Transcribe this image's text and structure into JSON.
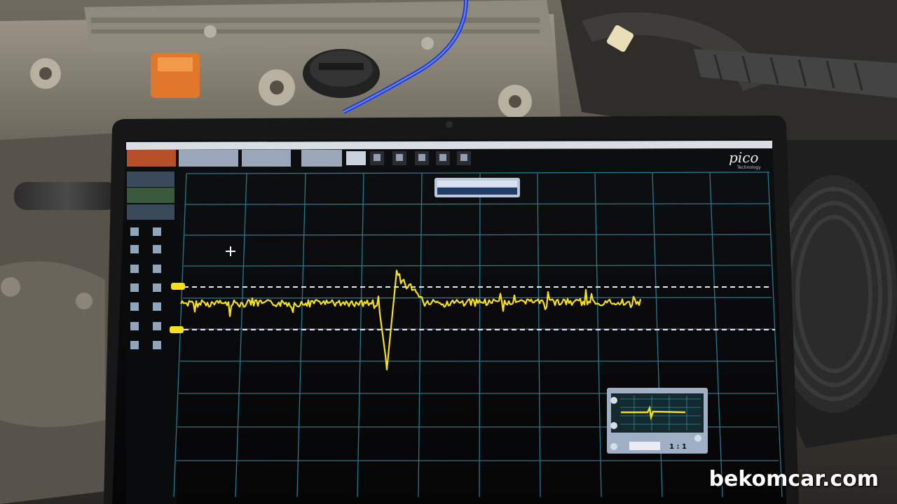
{
  "photo": {
    "subject": "Tablet running Pico oscilloscope software placed on a car engine bay",
    "brand_logo_text": "pico",
    "brand_logo_subtext": "Technology",
    "watermark": "bekomcar.com"
  },
  "scope": {
    "channel_readout": "1 : 1",
    "trace_color": "#f5e11a",
    "grid_color": "#2a8ea8"
  },
  "colors": {
    "screen_bg": "#0b0b0c",
    "bezel": "#171718",
    "toolbar": "#b9c4d2",
    "accent_orange": "#e0772a",
    "cable_blue": "#1f3fd0"
  }
}
